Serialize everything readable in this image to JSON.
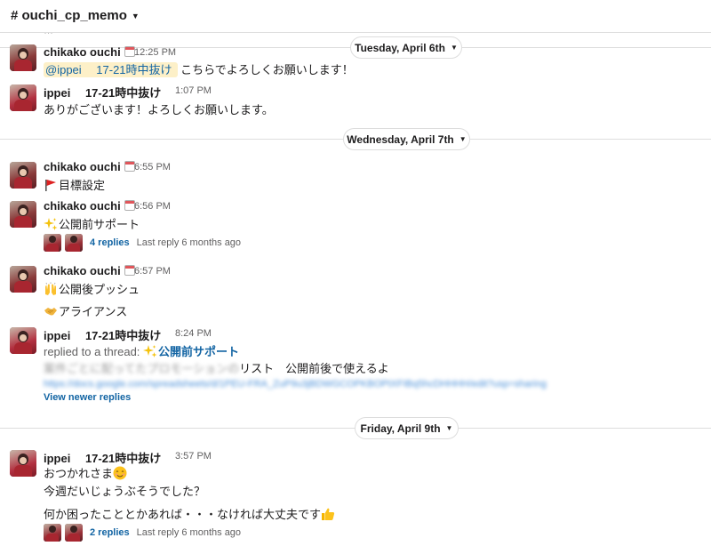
{
  "channel": {
    "name": "# ouchi_cp_memo"
  },
  "dates": {
    "d1": "Tuesday, April 6th",
    "d2": "Wednesday, April 7th",
    "d3": "Friday, April 9th"
  },
  "messages": {
    "m1": {
      "author": "chikako ouchi",
      "time": "12:25 PM",
      "mention": "@ippei　 17-21時中抜け",
      "text": " こちらでよろしくお願いします！"
    },
    "m2": {
      "author": "ippei　 17-21時中抜け",
      "time": "1:07 PM",
      "text": "ありがございます！よろしくお願いします。"
    },
    "m3": {
      "author": "chikako ouchi",
      "time": "6:55 PM",
      "text": "目標設定"
    },
    "m4": {
      "author": "chikako ouchi",
      "time": "6:56 PM",
      "text": "公開前サポート",
      "replies": "4 replies",
      "last_reply": "Last reply 6 months ago"
    },
    "m5": {
      "author": "chikako ouchi",
      "time": "6:57 PM",
      "text": "公開後プッシュ",
      "text2": "アライアンス"
    },
    "m6": {
      "author": "ippei　 17-21時中抜け",
      "time": "8:24 PM",
      "replied_prefix": "replied to a thread: ",
      "thread_name": "公開前サポート",
      "blur_text": "案件ごとに配ってたプロモーションの",
      "text_suffix": "リスト　公開前後で使えるよ",
      "blur_link": "https://docs.google.com/spreadsheets/d/1PEU-FRA_ZuP9u3jBDWGCOPKBOPtXFIBq5hcDHHHH/edit?usp=sharing",
      "view_newer": "View newer replies"
    },
    "m7": {
      "author": "ippei　 17-21時中抜け",
      "time": "3:57 PM",
      "line1": "おつかれさま",
      "line2": "今週だいじょうぶそうでした？",
      "line3": "何か困ったこととかあれば・・・なければ大丈夫です",
      "replies": "2 replies",
      "last_reply": "Last reply 6 months ago"
    }
  },
  "emoji": {
    "flag": "triangular-flag",
    "sparkles": "sparkles",
    "raised_hands": "raised-hands",
    "handshake": "handshake",
    "blush": "blush",
    "thumbsup": "thumbs-up"
  },
  "colors": {
    "link": "#1264a3",
    "mention_bg": "#fdf0c8",
    "divider": "#dddddd",
    "muted": "#616061"
  }
}
